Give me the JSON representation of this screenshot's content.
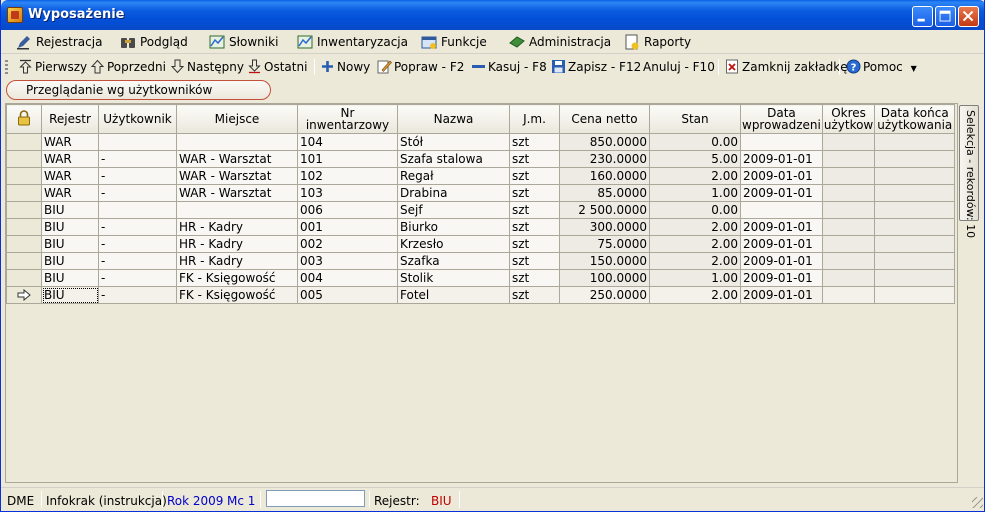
{
  "window": {
    "title": "Wyposażenie"
  },
  "menu": [
    {
      "label": "Rejestracja",
      "icon": "pencil-icon"
    },
    {
      "label": "Podgląd",
      "icon": "binoculars-icon"
    },
    {
      "label": "Słowniki",
      "icon": "chart-icon"
    },
    {
      "label": "Inwentaryzacja",
      "icon": "chart-icon"
    },
    {
      "label": "Funkcje",
      "icon": "window-icon"
    },
    {
      "label": "Administracja",
      "icon": "money-icon"
    },
    {
      "label": "Raporty",
      "icon": "report-icon"
    }
  ],
  "toolbar": {
    "first": "Pierwszy",
    "prev": "Poprzedni",
    "next": "Następny",
    "last": "Ostatni",
    "new": "Nowy",
    "edit": "Popraw - F2",
    "delete": "Kasuj - F8",
    "save": "Zapisz - F12",
    "cancel": "Anuluj - F10",
    "close_tab": "Zamknij zakładkę",
    "help": "Pomoc"
  },
  "tab": {
    "label": "Przeglądanie wg użytkowników"
  },
  "columns": [
    "Rejestr",
    "Użytkownik",
    "Miejsce",
    "Nr inwentarzowy",
    "Nazwa",
    "J.m.",
    "Cena netto",
    "Stan",
    "Data wprowadzeni",
    "Okres użytkow",
    "Data końca użytkowania"
  ],
  "rows": [
    {
      "rejestr": "WAR",
      "uzytkownik": "",
      "miejsce": "",
      "nr": "104",
      "nazwa": "Stół",
      "jm": "szt",
      "cena": "850.0000",
      "stan": "0.00",
      "data": "",
      "okres": "",
      "koniec": ""
    },
    {
      "rejestr": "WAR",
      "uzytkownik": "-",
      "miejsce": "WAR - Warsztat",
      "nr": "101",
      "nazwa": "Szafa stalowa",
      "jm": "szt",
      "cena": "230.0000",
      "stan": "5.00",
      "data": "2009-01-01",
      "okres": "",
      "koniec": ""
    },
    {
      "rejestr": "WAR",
      "uzytkownik": "-",
      "miejsce": "WAR - Warsztat",
      "nr": "102",
      "nazwa": "Regał",
      "jm": "szt",
      "cena": "160.0000",
      "stan": "2.00",
      "data": "2009-01-01",
      "okres": "",
      "koniec": ""
    },
    {
      "rejestr": "WAR",
      "uzytkownik": "-",
      "miejsce": "WAR - Warsztat",
      "nr": "103",
      "nazwa": "Drabina",
      "jm": "szt",
      "cena": "85.0000",
      "stan": "1.00",
      "data": "2009-01-01",
      "okres": "",
      "koniec": ""
    },
    {
      "rejestr": "BIU",
      "uzytkownik": "",
      "miejsce": "",
      "nr": "006",
      "nazwa": "Sejf",
      "jm": "szt",
      "cena": "2 500.0000",
      "stan": "0.00",
      "data": "",
      "okres": "",
      "koniec": ""
    },
    {
      "rejestr": "BIU",
      "uzytkownik": "-",
      "miejsce": "HR - Kadry",
      "nr": "001",
      "nazwa": "Biurko",
      "jm": "szt",
      "cena": "300.0000",
      "stan": "2.00",
      "data": "2009-01-01",
      "okres": "",
      "koniec": ""
    },
    {
      "rejestr": "BIU",
      "uzytkownik": "-",
      "miejsce": "HR - Kadry",
      "nr": "002",
      "nazwa": "Krzesło",
      "jm": "szt",
      "cena": "75.0000",
      "stan": "2.00",
      "data": "2009-01-01",
      "okres": "",
      "koniec": ""
    },
    {
      "rejestr": "BIU",
      "uzytkownik": "-",
      "miejsce": "HR - Kadry",
      "nr": "003",
      "nazwa": "Szafka",
      "jm": "szt",
      "cena": "150.0000",
      "stan": "2.00",
      "data": "2009-01-01",
      "okres": "",
      "koniec": ""
    },
    {
      "rejestr": "BIU",
      "uzytkownik": "-",
      "miejsce": "FK - Księgowość",
      "nr": "004",
      "nazwa": "Stolik",
      "jm": "szt",
      "cena": "100.0000",
      "stan": "1.00",
      "data": "2009-01-01",
      "okres": "",
      "koniec": ""
    },
    {
      "rejestr": "BIU",
      "uzytkownik": "-",
      "miejsce": "FK - Księgowość",
      "nr": "005",
      "nazwa": "Fotel",
      "jm": "szt",
      "cena": "250.0000",
      "stan": "2.00",
      "data": "2009-01-01",
      "okres": "",
      "koniec": ""
    }
  ],
  "side_panel": {
    "label": "Selekcja - rekordów: 10"
  },
  "status": {
    "app": "DME",
    "user": "Infokrak (instrukcja)",
    "year": "Rok 2009",
    "month": "Mc 1",
    "input_value": "",
    "register_label": "Rejestr:",
    "register_value": "BIU"
  },
  "colors": {
    "accent_blue": "#0000CC",
    "register_red": "#C00000",
    "title_blue": "#0A5FE6"
  }
}
